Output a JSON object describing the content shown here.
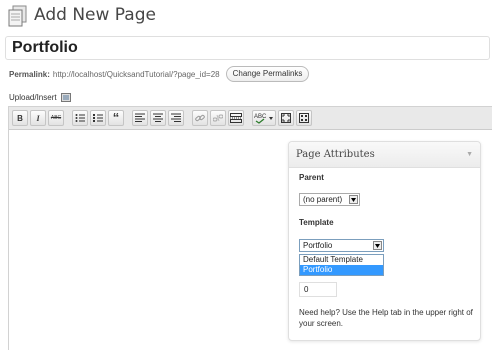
{
  "header": {
    "title": "Add New Page"
  },
  "post_title": {
    "value": "Portfolio"
  },
  "permalink": {
    "label": "Permalink:",
    "url": "http://localhost/QuicksandTutorial/?page_id=28",
    "change_button": "Change Permalinks"
  },
  "upload": {
    "label": "Upload/Insert"
  },
  "toolbar": {
    "buttons": [
      "bold",
      "italic",
      "strikethrough",
      "bullet-list",
      "numbered-list",
      "blockquote",
      "align-left",
      "align-center",
      "align-right",
      "link",
      "unlink",
      "insert-more",
      "spellcheck",
      "fullscreen",
      "kitchen-sink"
    ],
    "bold_label": "B",
    "italic_label": "I",
    "strike_label": "ABC",
    "quote_label": "“"
  },
  "page_attributes": {
    "title": "Page Attributes",
    "parent_label": "Parent",
    "parent_value": "(no parent)",
    "template_label": "Template",
    "template_value": "Portfolio",
    "template_options": [
      "Default Template",
      "Portfolio"
    ],
    "highlighted_option": "Portfolio",
    "order_value": "0",
    "help_text": "Need help? Use the Help tab in the upper right of your screen."
  }
}
